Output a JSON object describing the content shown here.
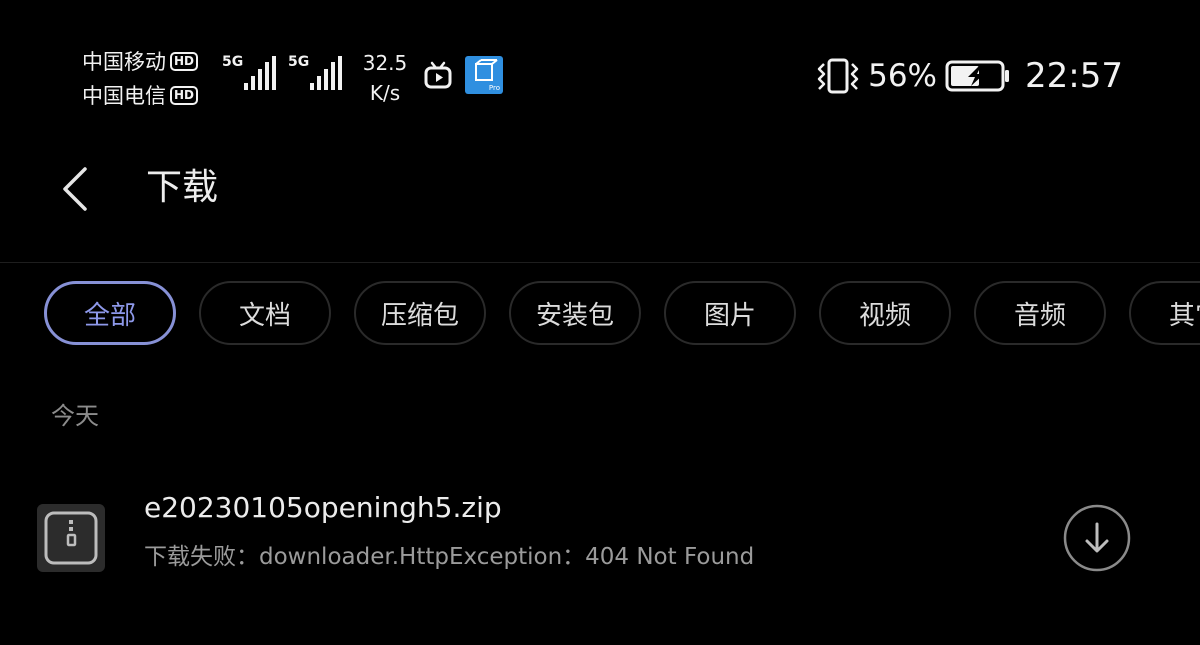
{
  "status_bar": {
    "carriers": [
      {
        "name": "中国移动",
        "badge": "HD"
      },
      {
        "name": "中国电信",
        "badge": "HD"
      }
    ],
    "signal": [
      {
        "type": "5G"
      },
      {
        "type": "5G"
      }
    ],
    "net_speed": {
      "value": "32.5",
      "unit": "K/s"
    },
    "battery_percent": "56%",
    "time": "22:57"
  },
  "header": {
    "title": "下载"
  },
  "filters": [
    {
      "label": "全部",
      "active": true
    },
    {
      "label": "文档"
    },
    {
      "label": "压缩包"
    },
    {
      "label": "安装包"
    },
    {
      "label": "图片"
    },
    {
      "label": "视频"
    },
    {
      "label": "音频"
    },
    {
      "label": "其它"
    }
  ],
  "sections": [
    {
      "label": "今天",
      "items": [
        {
          "name": "e20230105openingh5.zip",
          "status": "下载失败：downloader.HttpException：404 Not Found"
        }
      ]
    }
  ],
  "colors": {
    "background": "#000000",
    "accent": "#8e99ea",
    "primary_text": "#ececec",
    "secondary_text": "#9b9b9b"
  }
}
